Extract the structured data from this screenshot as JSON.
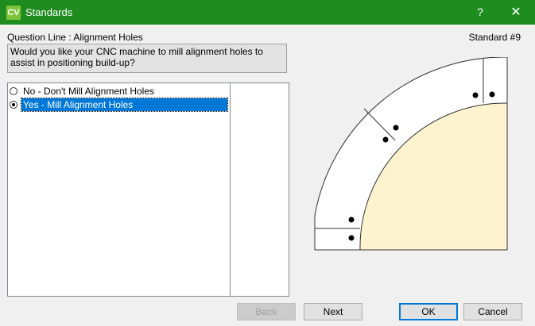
{
  "window": {
    "icon_text": "CV",
    "title": "Standards",
    "help": "?",
    "close": "✕"
  },
  "question": {
    "line": "Question Line : Alignment Holes",
    "standard": "Standard #9",
    "prompt": "Would you like your CNC machine to mill alignment holes to assist in positioning build-up?"
  },
  "options": [
    {
      "label": "No - Don't Mill Alignment Holes",
      "selected": false
    },
    {
      "label": "Yes - Mill Alignment Holes",
      "selected": true
    }
  ],
  "buttons": {
    "back": "Back",
    "next": "Next",
    "ok": "OK",
    "cancel": "Cancel"
  },
  "colors": {
    "titlebar": "#1f8c1f",
    "selection": "#0078d7",
    "counter_fill": "#fdf3cf"
  }
}
